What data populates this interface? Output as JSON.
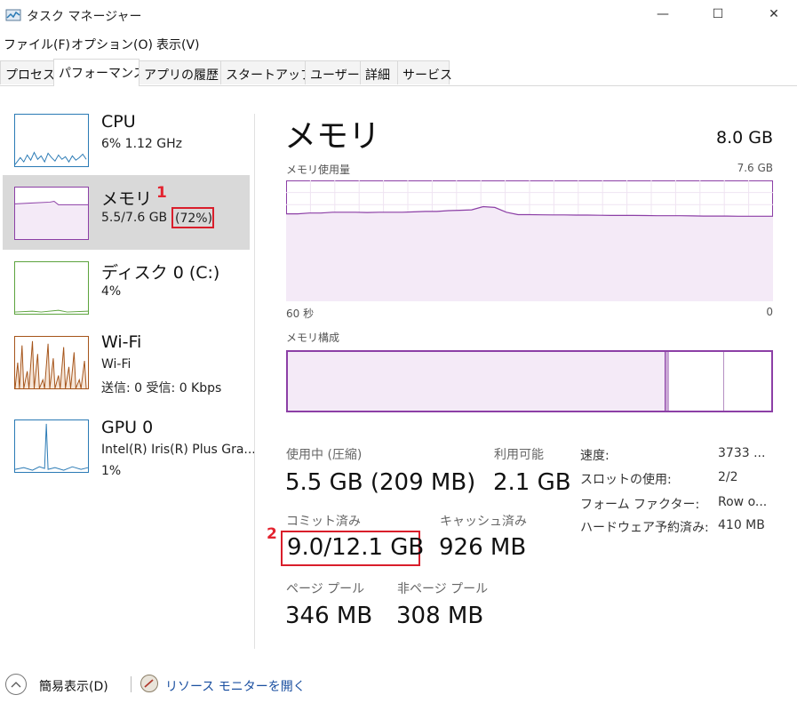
{
  "window": {
    "title": "タスク マネージャー",
    "minimize_glyph": "—",
    "maximize_glyph": "☐",
    "close_glyph": "✕"
  },
  "menu": {
    "items": [
      "ファイル(F)",
      "オプション(O)",
      "表示(V)"
    ]
  },
  "tabs": {
    "items": [
      "プロセス",
      "パフォーマンス",
      "アプリの履歴",
      "スタートアップ",
      "ユーザー",
      "詳細",
      "サービス"
    ],
    "active": "パフォーマンス"
  },
  "sidebar": {
    "items": [
      {
        "title": "CPU",
        "line1": "6% 1.12 GHz",
        "line2": "",
        "color": "#2a7ab5"
      },
      {
        "title": "メモリ",
        "line1": "5.5/7.6 GB",
        "pct": "(72%)",
        "line2": "",
        "color": "#8c3fa6"
      },
      {
        "title": "ディスク 0 (C:)",
        "line1": "4%",
        "line2": "",
        "color": "#5ca33d"
      },
      {
        "title": "Wi-Fi",
        "line1": "Wi-Fi",
        "line2": "送信: 0 受信: 0 Kbps",
        "color": "#a5541a"
      },
      {
        "title": "GPU 0",
        "line1": "Intel(R) Iris(R) Plus Gra...",
        "line2": "1%",
        "color": "#2a7ab5"
      }
    ]
  },
  "main": {
    "heading": "メモリ",
    "total": "8.0 GB",
    "usage_label": "メモリ使用量",
    "usage_max": "7.6 GB",
    "axis_left": "60 秒",
    "axis_right": "0",
    "composition_label": "メモリ構成",
    "composition": {
      "in_use_fraction": 0.78,
      "modified_fraction": 0.008,
      "standby_fraction": 0.112
    },
    "stats": {
      "in_use_label": "使用中 (圧縮)",
      "in_use_value": "5.5 GB (209 MB)",
      "available_label": "利用可能",
      "available_value": "2.1 GB",
      "committed_label": "コミット済み",
      "committed_value": "9.0/12.1 GB",
      "cached_label": "キャッシュ済み",
      "cached_value": "926 MB",
      "paged_label": "ページ プール",
      "paged_value": "346 MB",
      "nonpaged_label": "非ページ プール",
      "nonpaged_value": "308 MB"
    },
    "specs": [
      {
        "key": "速度:",
        "value": "3733 ..."
      },
      {
        "key": "スロットの使用:",
        "value": "2/2"
      },
      {
        "key": "フォーム ファクター:",
        "value": "Row o..."
      },
      {
        "key": "ハードウェア予約済み:",
        "value": "410 MB"
      }
    ]
  },
  "annotations": {
    "one": "1",
    "two": "2"
  },
  "footer": {
    "fewer_details": "簡易表示(D)",
    "resource_monitor": "リソース モニターを開く"
  },
  "chart_data": {
    "type": "line",
    "title": "メモリ使用量",
    "xlabel": "",
    "ylabel": "",
    "x_range_seconds": [
      60,
      0
    ],
    "ylim": [
      0,
      7.6
    ],
    "series": [
      {
        "values": [
          5.5,
          5.5,
          5.55,
          5.55,
          5.6,
          5.6,
          5.6,
          5.58,
          5.6,
          5.6,
          5.6,
          5.62,
          5.65,
          5.65,
          5.7,
          5.72,
          5.75,
          5.95,
          5.9,
          5.6,
          5.45,
          5.45,
          5.44,
          5.43,
          5.43,
          5.42,
          5.42,
          5.41,
          5.4,
          5.4,
          5.4,
          5.39,
          5.38,
          5.38,
          5.38,
          5.37,
          5.36,
          5.36,
          5.36,
          5.35,
          5.35,
          5.35,
          5.35
        ]
      }
    ]
  }
}
